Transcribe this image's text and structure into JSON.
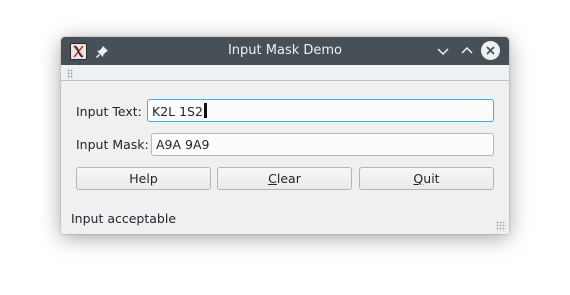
{
  "window": {
    "title": "Input Mask Demo"
  },
  "form": {
    "input_text_label": "Input Text:",
    "input_text_value": "K2L 1S2",
    "input_mask_label": "Input Mask:",
    "input_mask_value": "A9A 9A9"
  },
  "buttons": {
    "help_label": "Help",
    "clear_label": "Clear",
    "clear_mnemonic": "C",
    "clear_rest": "lear",
    "quit_label": "Quit",
    "quit_mnemonic": "Q",
    "quit_rest": "uit"
  },
  "status": {
    "message": "Input acceptable"
  },
  "icons": {
    "app": "application-icon",
    "pin": "pin-icon",
    "minimize": "minimize-icon",
    "maximize": "maximize-icon",
    "close": "close-icon"
  },
  "colors": {
    "titlebar": "#475057",
    "window_bg": "#eff0f1",
    "focus_border": "#3daee9"
  }
}
